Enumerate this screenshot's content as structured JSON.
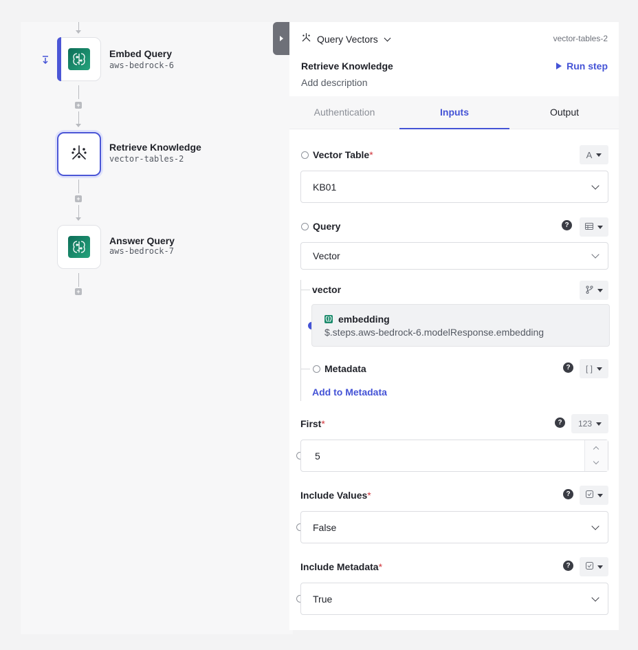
{
  "flow": {
    "nodes": [
      {
        "title": "Embed Query",
        "subtitle": "aws-bedrock-6",
        "icon": "bedrock-brain-icon"
      },
      {
        "title": "Retrieve Knowledge",
        "subtitle": "vector-tables-2",
        "icon": "vector-tables-icon"
      },
      {
        "title": "Answer Query",
        "subtitle": "aws-bedrock-7",
        "icon": "bedrock-brain-icon"
      }
    ]
  },
  "panel": {
    "step_type": "Query Vectors",
    "step_id": "vector-tables-2",
    "step_title": "Retrieve Knowledge",
    "add_description": "Add description",
    "run_step": "Run step",
    "tabs": [
      "Authentication",
      "Inputs",
      "Output"
    ],
    "active_tab": "Inputs",
    "fields": {
      "vector_table": {
        "label": "Vector Table",
        "required": "*",
        "type_icon": "A",
        "value": "KB01"
      },
      "query": {
        "label": "Query",
        "value": "Vector"
      },
      "vector": {
        "label": "vector",
        "ref_name": "embedding",
        "ref_path": "$.steps.aws-bedrock-6.modelResponse.embedding"
      },
      "metadata": {
        "label": "Metadata",
        "add_link": "Add to Metadata"
      },
      "first": {
        "label": "First",
        "required": "*",
        "type_icon": "123",
        "value": "5"
      },
      "include_values": {
        "label": "Include Values",
        "required": "*",
        "value": "False"
      },
      "include_metadata": {
        "label": "Include Metadata",
        "required": "*",
        "value": "True"
      }
    },
    "help_glyph": "?"
  },
  "colors": {
    "accent": "#4453d6",
    "required": "#d0343b",
    "bedrock": "#1a8a6b"
  }
}
